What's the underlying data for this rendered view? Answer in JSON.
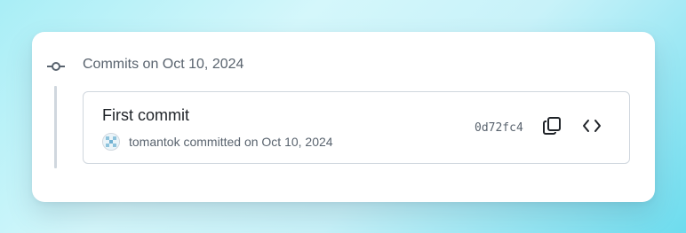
{
  "group": {
    "heading": "Commits on Oct 10, 2024"
  },
  "commit": {
    "title": "First commit",
    "author": "tomantok",
    "byline_rest": " committed on Oct 10, 2024",
    "sha": "0d72fc4"
  },
  "icons": {
    "timeline": "git-commit-icon",
    "copy": "copy-icon",
    "browse": "code-icon"
  },
  "colors": {
    "text_primary": "#1f2328",
    "text_muted": "#59636e",
    "border": "#d0d7de"
  }
}
